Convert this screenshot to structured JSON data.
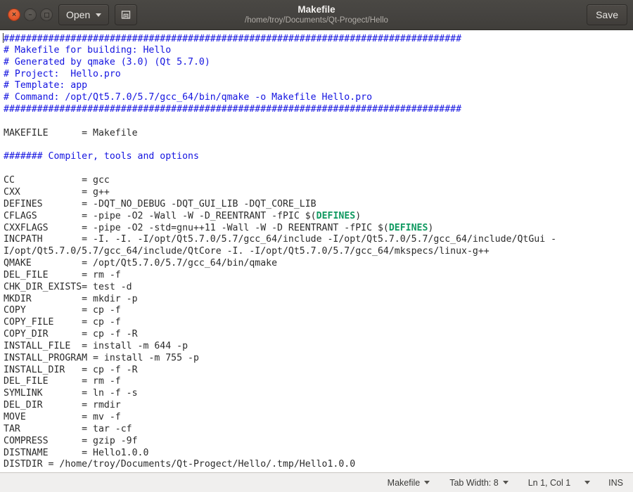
{
  "window": {
    "title": "Makefile",
    "subtitle": "/home/troy/Documents/Qt-Progect/Hello",
    "close_glyph": "×",
    "minimize_glyph": "–"
  },
  "headerbar": {
    "open_label": "Open",
    "open_caret": "▾",
    "new_document_tooltip": "New Document",
    "save_label": "Save"
  },
  "editor": {
    "language": "makefile",
    "comment_color": "#1414e0",
    "variable_color": "#0f9960",
    "text_color": "#2b2b2b",
    "background": "#ffffff",
    "lines": [
      {
        "type": "comment",
        "text": "##################################################################################"
      },
      {
        "type": "comment",
        "text": "# Makefile for building: Hello"
      },
      {
        "type": "comment",
        "text": "# Generated by qmake (3.0) (Qt 5.7.0)"
      },
      {
        "type": "comment",
        "text": "# Project:  Hello.pro"
      },
      {
        "type": "comment",
        "text": "# Template: app"
      },
      {
        "type": "comment",
        "text": "# Command: /opt/Qt5.7.0/5.7/gcc_64/bin/qmake -o Makefile Hello.pro"
      },
      {
        "type": "comment",
        "text": "##################################################################################"
      },
      {
        "type": "blank",
        "text": ""
      },
      {
        "type": "plain",
        "text": "MAKEFILE      = Makefile"
      },
      {
        "type": "blank",
        "text": ""
      },
      {
        "type": "comment",
        "text": "####### Compiler, tools and options"
      },
      {
        "type": "blank",
        "text": ""
      },
      {
        "type": "plain",
        "text": "CC            = gcc"
      },
      {
        "type": "plain",
        "text": "CXX           = g++"
      },
      {
        "type": "plain",
        "text": "DEFINES       = -DQT_NO_DEBUG -DQT_GUI_LIB -DQT_CORE_LIB"
      },
      {
        "type": "var",
        "pre": "CFLAGS        = -pipe -O2 -Wall -W -D_REENTRANT -fPIC $(",
        "varname": "DEFINES",
        "post": ")"
      },
      {
        "type": "var",
        "pre": "CXXFLAGS      = -pipe -O2 -std=gnu++11 -Wall -W -D REENTRANT -fPIC $(",
        "varname": "DEFINES",
        "post": ")"
      },
      {
        "type": "plain",
        "text": "INCPATH       = -I. -I. -I/opt/Qt5.7.0/5.7/gcc_64/include -I/opt/Qt5.7.0/5.7/gcc_64/include/QtGui -"
      },
      {
        "type": "plain",
        "text": "I/opt/Qt5.7.0/5.7/gcc_64/include/QtCore -I. -I/opt/Qt5.7.0/5.7/gcc_64/mkspecs/linux-g++"
      },
      {
        "type": "plain",
        "text": "QMAKE         = /opt/Qt5.7.0/5.7/gcc_64/bin/qmake"
      },
      {
        "type": "plain",
        "text": "DEL_FILE      = rm -f"
      },
      {
        "type": "plain",
        "text": "CHK_DIR_EXISTS= test -d"
      },
      {
        "type": "plain",
        "text": "MKDIR         = mkdir -p"
      },
      {
        "type": "plain",
        "text": "COPY          = cp -f"
      },
      {
        "type": "plain",
        "text": "COPY_FILE     = cp -f"
      },
      {
        "type": "plain",
        "text": "COPY_DIR      = cp -f -R"
      },
      {
        "type": "plain",
        "text": "INSTALL_FILE  = install -m 644 -p"
      },
      {
        "type": "plain",
        "text": "INSTALL_PROGRAM = install -m 755 -p"
      },
      {
        "type": "plain",
        "text": "INSTALL_DIR   = cp -f -R"
      },
      {
        "type": "plain",
        "text": "DEL_FILE      = rm -f"
      },
      {
        "type": "plain",
        "text": "SYMLINK       = ln -f -s"
      },
      {
        "type": "plain",
        "text": "DEL_DIR       = rmdir"
      },
      {
        "type": "plain",
        "text": "MOVE          = mv -f"
      },
      {
        "type": "plain",
        "text": "TAR           = tar -cf"
      },
      {
        "type": "plain",
        "text": "COMPRESS      = gzip -9f"
      },
      {
        "type": "plain",
        "text": "DISTNAME      = Hello1.0.0"
      },
      {
        "type": "plain",
        "text": "DISTDIR = /home/troy/Documents/Qt-Progect/Hello/.tmp/Hello1.0.0"
      }
    ]
  },
  "statusbar": {
    "language_label": "Makefile",
    "tab_width_label": "Tab Width: 8",
    "position_label": "Ln 1, Col 1",
    "insert_mode_label": "INS"
  }
}
